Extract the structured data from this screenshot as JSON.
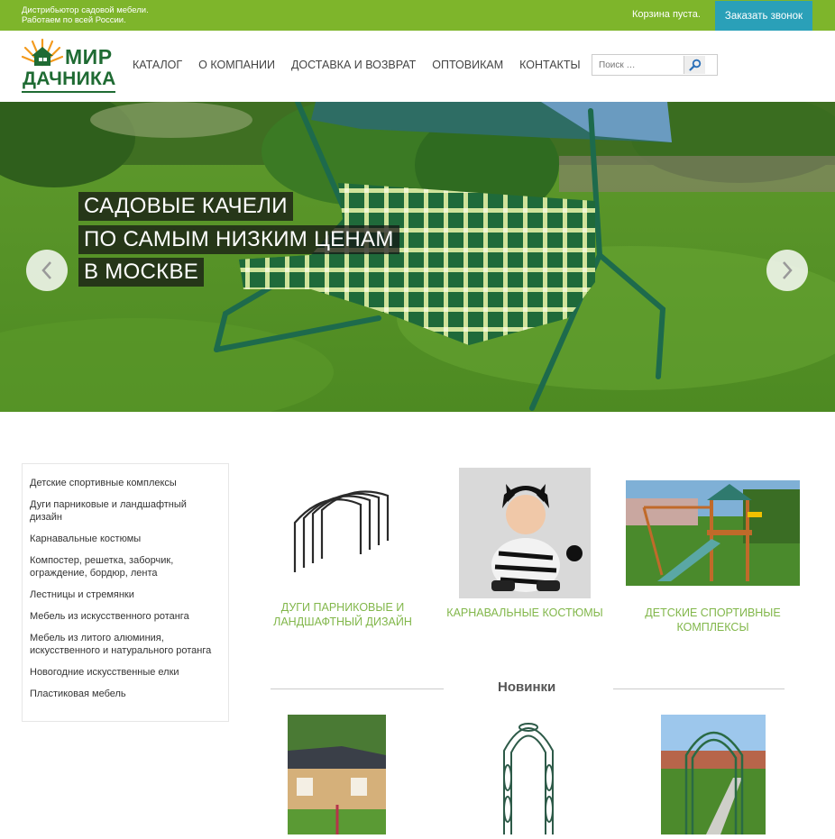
{
  "topbar": {
    "tagline_1": "Дистрибьютор садовой мебели.",
    "tagline_2": "Работаем по всей России.",
    "cart": "Корзина пуста.",
    "callback": "Заказать звонок"
  },
  "logo": {
    "word1": "МИР",
    "word2": "ДАЧНИКА"
  },
  "nav": [
    "КАТАЛОГ",
    "О КОМПАНИИ",
    "ДОСТАВКА И ВОЗВРАТ",
    "ОПТОВИКАМ",
    "КОНТАКТЫ"
  ],
  "search": {
    "placeholder": "Поиск …",
    "icon": "magnifier-icon"
  },
  "hero": {
    "lines": [
      "САДОВЫЕ КАЧЕЛИ",
      "ПО САМЫМ НИЗКИМ ЦЕНАМ",
      "В МОСКВЕ"
    ],
    "prev_icon": "chevron-left-icon",
    "next_icon": "chevron-right-icon"
  },
  "sidebar": [
    "Детские спортивные комплексы",
    "Дуги парниковые и ландшафтный дизайн",
    "Карнавальные костюмы",
    "Компостер, решетка, заборчик, ограждение, бордюр, лента",
    "Лестницы и стремянки",
    "Мебель из искусственного ротанга",
    "Мебель из литого алюминия, искусственного и натурального ротанга",
    "Новогодние искусственные елки",
    "Пластиковая мебель"
  ],
  "categories": [
    "ДУГИ ПАРНИКОВЫЕ И ЛАНДШАФТНЫЙ ДИЗАЙН",
    "КАРНАВАЛЬНЫЕ КОСТЮМЫ",
    "ДЕТСКИЕ СПОРТИВНЫЕ КОМПЛЕКСЫ"
  ],
  "new_title": "Новинки",
  "colors": {
    "green": "#7eb52b",
    "teal": "#2aa0b8",
    "caption": "#82b74b",
    "logo": "#1f6b33"
  }
}
